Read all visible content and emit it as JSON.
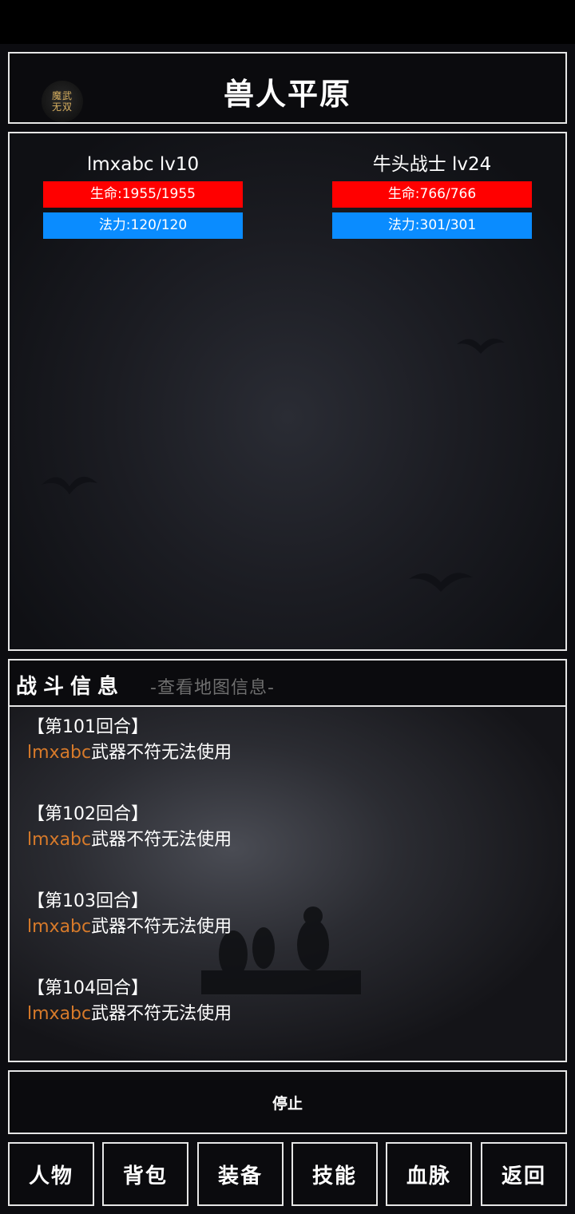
{
  "header": {
    "title": "兽人平原",
    "logo_text": [
      "魔武",
      "无双"
    ]
  },
  "player": {
    "name": "lmxabc  lv10",
    "hp": "生命:1955/1955",
    "mp": "法力:120/120",
    "hp_fraction": 1.0,
    "mp_fraction": 1.0
  },
  "enemy": {
    "name": "牛头战士  lv24",
    "hp": "生命:766/766",
    "mp": "法力:301/301",
    "hp_fraction": 1.0,
    "mp_fraction": 1.0
  },
  "log": {
    "title": "战斗信息",
    "map_link": "-查看地图信息-",
    "entries": [
      {
        "round": "【第101回合】",
        "actor": "lmxabc",
        "text": "武器不符无法使用"
      },
      {
        "round": "【第102回合】",
        "actor": "lmxabc",
        "text": "武器不符无法使用"
      },
      {
        "round": "【第103回合】",
        "actor": "lmxabc",
        "text": "武器不符无法使用"
      },
      {
        "round": "【第104回合】",
        "actor": "lmxabc",
        "text": "武器不符无法使用"
      }
    ]
  },
  "stop_button": "停止",
  "nav": [
    "人物",
    "背包",
    "装备",
    "技能",
    "血脉",
    "返回"
  ],
  "colors": {
    "hp_bar": "#ff0000",
    "mp_bar": "#0a8cff",
    "actor_name": "#d77a2a",
    "border": "#e6e6e6"
  }
}
